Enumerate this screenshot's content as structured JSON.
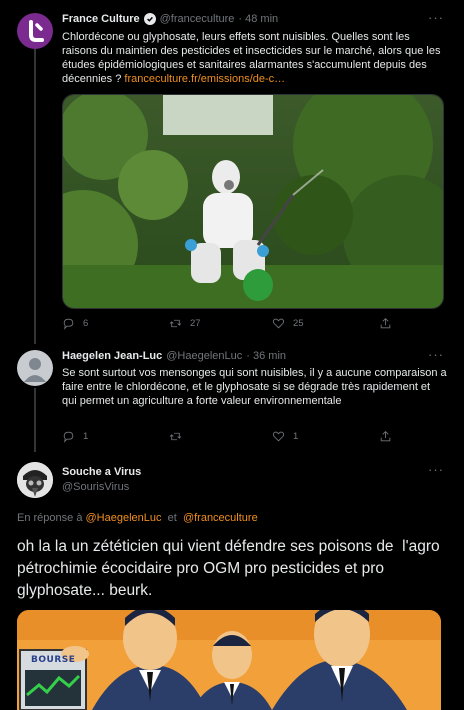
{
  "tweet1": {
    "name": "France Culture",
    "handle": "@franceculture",
    "time": "· 48 min",
    "text": "Chlordécone ou glyphosate, leurs effets sont nuisibles. Quelles sont les raisons du maintien des pesticides et insecticides sur le marché, alors que les études épidémiologiques et sanitaires alarmantes s'accumulent depuis des décennies ?",
    "link": "franceculture.fr/emissions/de-c…",
    "replies": "6",
    "retweets": "27",
    "likes": "25"
  },
  "tweet2": {
    "name": "Haegelen Jean-Luc",
    "handle": "@HaegelenLuc",
    "time": "· 36 min",
    "text": "Se sont surtout vos mensonges qui sont nuisibles, il y a aucune comparaison a faire entre le chlordécone, et le glyphosate si se dégrade très rapidement et qui permet un agriculture a forte valeur environnementale",
    "replies": "1",
    "retweets": "",
    "likes": "1"
  },
  "tweet3": {
    "name": "Souche a Virus",
    "handle": "@SourisVirus",
    "reply_prefix": "En réponse à",
    "reply_to_1": "@HaegelenLuc",
    "reply_and": "et",
    "reply_to_2": "@franceculture",
    "text": "oh la la un zététicien qui vient défendre ses poisons de  l'agro pétrochimie écocidaire pro OGM pro pesticides et pro glyphosate... beurk.",
    "cartoon_sign": "BOURSE"
  },
  "more_label": "···",
  "colors": {
    "background": "#000000",
    "link": "#f08f1e",
    "muted": "#71767b",
    "france_culture_purple": "#7b2a8f"
  }
}
